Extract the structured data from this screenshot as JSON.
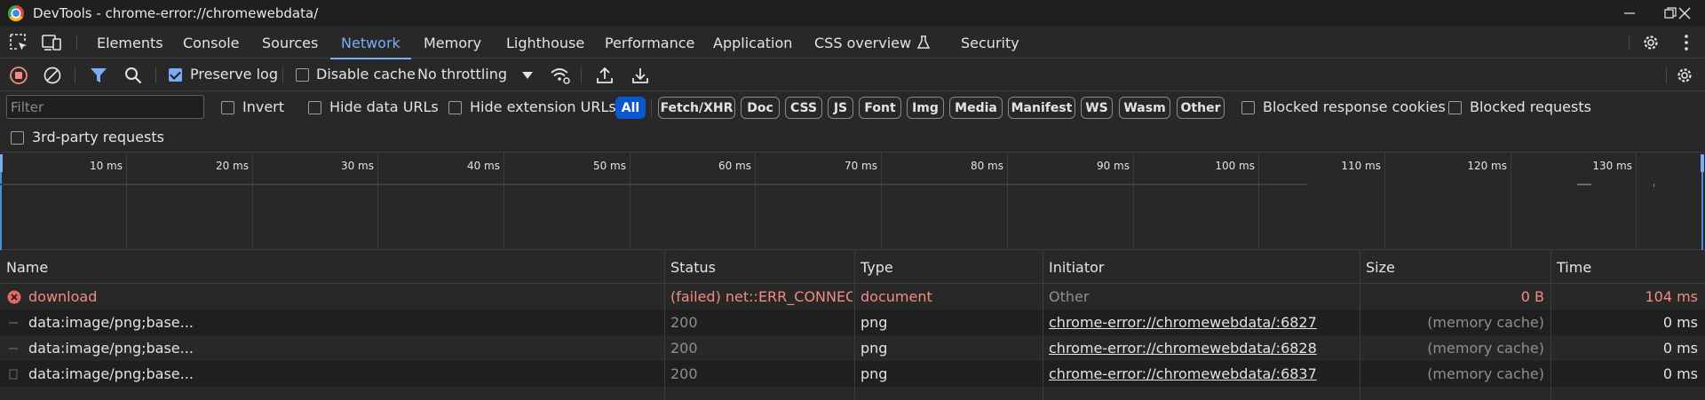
{
  "window": {
    "title": "DevTools - chrome-error://chromewebdata/",
    "minimize": "—",
    "maximize": "❐",
    "close": "✕"
  },
  "tabs": [
    "Elements",
    "Console",
    "Sources",
    "Network",
    "Memory",
    "Lighthouse",
    "Performance",
    "Application",
    "CSS overview",
    "Security"
  ],
  "active_tab": "Network",
  "toolbar": {
    "preserve_log": "Preserve log",
    "disable_cache": "Disable cache",
    "throttling": "No throttling"
  },
  "filter": {
    "placeholder": "Filter",
    "invert": "Invert",
    "hide_data_urls": "Hide data URLs",
    "hide_extension_urls": "Hide extension URLs",
    "types": [
      "All",
      "Fetch/XHR",
      "Doc",
      "CSS",
      "JS",
      "Font",
      "Img",
      "Media",
      "Manifest",
      "WS",
      "Wasm",
      "Other"
    ],
    "blocked_response_cookies": "Blocked response cookies",
    "blocked_requests": "Blocked requests",
    "third_party": "3rd-party requests"
  },
  "timeline": {
    "ticks": [
      "10 ms",
      "20 ms",
      "30 ms",
      "40 ms",
      "50 ms",
      "60 ms",
      "70 ms",
      "80 ms",
      "90 ms",
      "100 ms",
      "110 ms",
      "120 ms",
      "130 ms"
    ]
  },
  "table": {
    "headers": {
      "name": "Name",
      "status": "Status",
      "type": "Type",
      "initiator": "Initiator",
      "size": "Size",
      "time": "Time"
    },
    "rows": [
      {
        "name": "download",
        "status": "(failed) net::ERR_CONNEC...",
        "type": "document",
        "initiator": "Other",
        "size": "0 B",
        "time": "104 ms"
      },
      {
        "name": "data:image/png;base...",
        "status": "200",
        "type": "png",
        "initiator": "chrome-error://chromewebdata/:6827",
        "size": "(memory cache)",
        "time": "0 ms"
      },
      {
        "name": "data:image/png;base...",
        "status": "200",
        "type": "png",
        "initiator": "chrome-error://chromewebdata/:6828",
        "size": "(memory cache)",
        "time": "0 ms"
      },
      {
        "name": "data:image/png;base...",
        "status": "200",
        "type": "png",
        "initiator": "chrome-error://chromewebdata/:6837",
        "size": "(memory cache)",
        "time": "0 ms"
      }
    ]
  },
  "colors": {
    "accent": "#7cacf8",
    "error": "#f28b82",
    "record": "#f28b82",
    "pill_active": "#0b57d0"
  }
}
